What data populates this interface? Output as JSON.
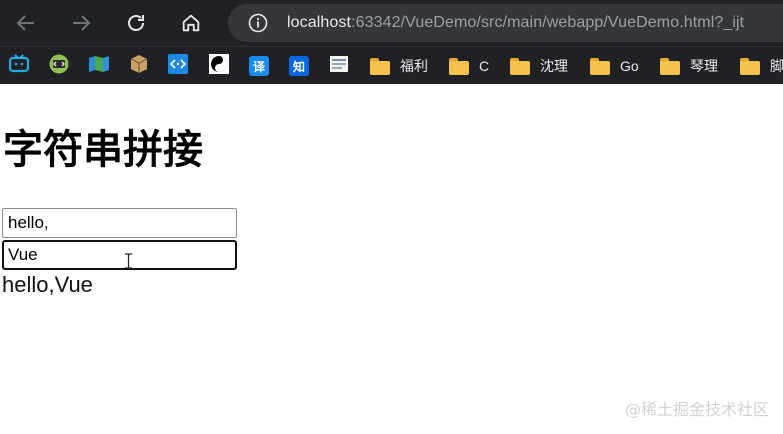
{
  "browser": {
    "nav": {
      "back_icon": "arrow-left-icon",
      "forward_icon": "arrow-right-icon",
      "reload_icon": "reload-icon",
      "home_icon": "home-icon"
    },
    "address": {
      "host": "localhost",
      "path": ":63342/VueDemo/src/main/webapp/VueDemo.html?_ijt"
    },
    "colors": {
      "frame": "#202124",
      "omnibox": "#35363a",
      "text": "#e8eaed",
      "muted": "#9aa0a6"
    }
  },
  "bookmarks": {
    "items": [
      {
        "icon": "bilibili-icon",
        "label": ""
      },
      {
        "icon": "code-icon",
        "label": ""
      },
      {
        "icon": "map-icon",
        "label": ""
      },
      {
        "icon": "box-icon",
        "label": ""
      },
      {
        "icon": "dev-tools-icon",
        "label": ""
      },
      {
        "icon": "yin-yang-icon",
        "label": ""
      },
      {
        "icon": "translate-icon",
        "glyph": "译",
        "label": ""
      },
      {
        "icon": "zhihu-icon",
        "glyph": "知",
        "label": ""
      },
      {
        "icon": "page-icon",
        "label": ""
      },
      {
        "icon": "folder-icon",
        "label": "福利"
      },
      {
        "icon": "folder-icon",
        "label": "C"
      },
      {
        "icon": "folder-icon",
        "label": "沈理"
      },
      {
        "icon": "folder-icon",
        "label": "Go"
      },
      {
        "icon": "folder-icon",
        "label": "琴理"
      },
      {
        "icon": "folder-icon",
        "label": "脚"
      }
    ]
  },
  "page": {
    "heading": "字符串拼接",
    "input_a": "hello,",
    "input_b": "Vue",
    "result": "hello,Vue"
  },
  "watermark": "@稀土掘金技术社区"
}
